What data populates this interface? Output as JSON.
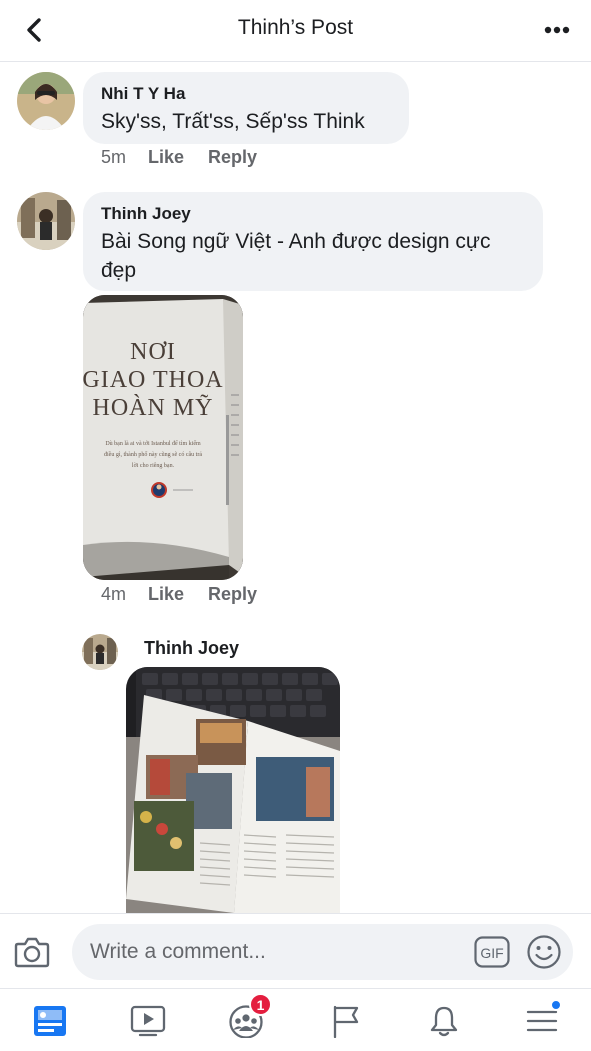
{
  "header": {
    "title": "Thinh’s Post",
    "back_icon": "chevron-left-icon",
    "more_icon": "more-horizontal-icon"
  },
  "comments": [
    {
      "author": "Nhi T Y Ha",
      "text": "Sky'ss, Trất'ss, Sếp'ss Think",
      "time": "5m",
      "like_label": "Like",
      "reply_label": "Reply"
    },
    {
      "author": "Thinh Joey",
      "text_line1": "Bài Song ngữ Việt - Anh được design cực",
      "text_line2": "đẹp",
      "time": "4m",
      "like_label": "Like",
      "reply_label": "Reply",
      "photo": {
        "title_line1": "NƠI",
        "title_line2": "GIAO THOA",
        "title_line3": "HOÀN MỸ",
        "body_line1": "Dù bạn là ai và tới Istanbul để tìm kiếm",
        "body_line2": "điều gì, thành phố này cũng sẽ có câu trả",
        "body_line3": "lời cho riêng bạn."
      }
    },
    {
      "author": "Thinh Joey"
    }
  ],
  "composer": {
    "placeholder": "Write a comment...",
    "gif_label": "GIF",
    "camera_icon": "camera-icon",
    "emoji_icon": "smiley-icon"
  },
  "nav": {
    "items": [
      {
        "name": "news-feed",
        "icon": "news-feed-icon",
        "active": true
      },
      {
        "name": "watch",
        "icon": "video-play-icon"
      },
      {
        "name": "groups",
        "icon": "groups-icon",
        "badge": "1"
      },
      {
        "name": "pages",
        "icon": "flag-icon"
      },
      {
        "name": "notifications",
        "icon": "bell-icon"
      },
      {
        "name": "menu",
        "icon": "hamburger-menu-icon",
        "dot": true
      }
    ]
  },
  "colors": {
    "accent": "#1877f2",
    "badge": "#e41e3f",
    "bubble": "#f0f2f5",
    "secondary_text": "#65676b"
  }
}
